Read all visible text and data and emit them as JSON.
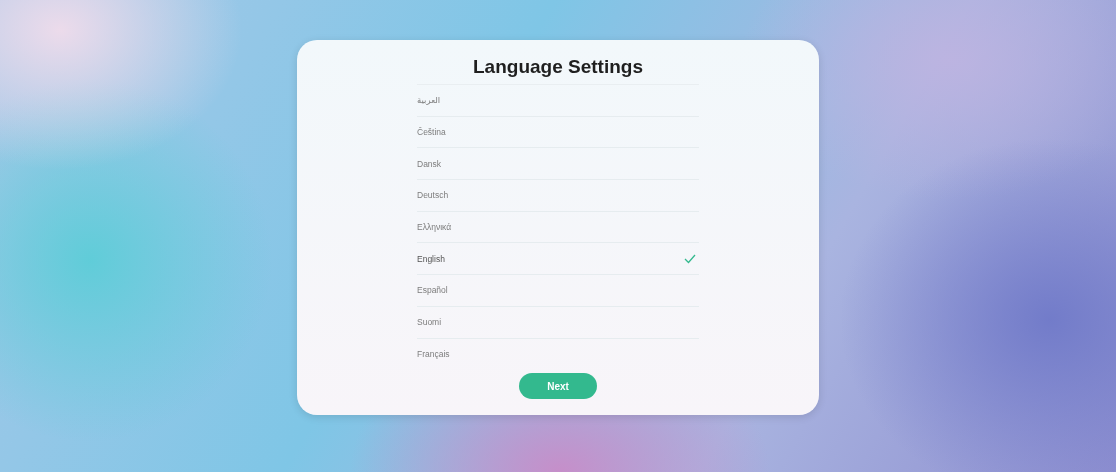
{
  "dialog": {
    "title": "Language Settings",
    "languages": [
      {
        "label": "العربية",
        "selected": false
      },
      {
        "label": "Čeština",
        "selected": false
      },
      {
        "label": "Dansk",
        "selected": false
      },
      {
        "label": "Deutsch",
        "selected": false
      },
      {
        "label": "Ελληνικά",
        "selected": false
      },
      {
        "label": "English",
        "selected": true
      },
      {
        "label": "Español",
        "selected": false
      },
      {
        "label": "Suomi",
        "selected": false
      },
      {
        "label": "Français",
        "selected": false
      }
    ],
    "button": "Next"
  }
}
